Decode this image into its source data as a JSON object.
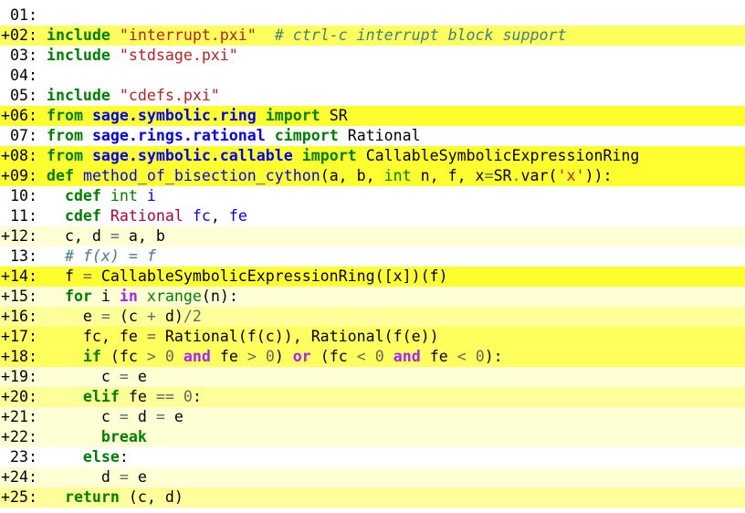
{
  "code_view": {
    "lines": [
      {
        "number": " 01:",
        "intensity": 0,
        "tokens": []
      },
      {
        "number": "+02:",
        "intensity": 3,
        "tokens": [
          {
            "t": " "
          },
          {
            "t": "include",
            "c": "kw"
          },
          {
            "t": " "
          },
          {
            "t": "\"interrupt.pxi\"",
            "c": "str"
          },
          {
            "t": "  "
          },
          {
            "t": "# ctrl-c interrupt block support",
            "c": "com"
          }
        ]
      },
      {
        "number": " 03:",
        "intensity": 0,
        "tokens": [
          {
            "t": " "
          },
          {
            "t": "include",
            "c": "kw"
          },
          {
            "t": " "
          },
          {
            "t": "\"stdsage.pxi\"",
            "c": "str"
          }
        ]
      },
      {
        "number": " 04:",
        "intensity": 0,
        "tokens": []
      },
      {
        "number": " 05:",
        "intensity": 0,
        "tokens": [
          {
            "t": " "
          },
          {
            "t": "include",
            "c": "kw"
          },
          {
            "t": " "
          },
          {
            "t": "\"cdefs.pxi\"",
            "c": "str"
          }
        ]
      },
      {
        "number": "+06:",
        "intensity": 4,
        "tokens": [
          {
            "t": " "
          },
          {
            "t": "from",
            "c": "kw"
          },
          {
            "t": " "
          },
          {
            "t": "sage.symbolic.ring",
            "c": "ns"
          },
          {
            "t": " "
          },
          {
            "t": "import",
            "c": "kw"
          },
          {
            "t": " "
          },
          {
            "t": "SR",
            "c": "n"
          }
        ]
      },
      {
        "number": " 07:",
        "intensity": 0,
        "tokens": [
          {
            "t": " "
          },
          {
            "t": "from",
            "c": "kw"
          },
          {
            "t": " "
          },
          {
            "t": "sage.rings.rational",
            "c": "ns"
          },
          {
            "t": " "
          },
          {
            "t": "cimport",
            "c": "kw"
          },
          {
            "t": " "
          },
          {
            "t": "Rational",
            "c": "n"
          }
        ]
      },
      {
        "number": "+08:",
        "intensity": 4,
        "tokens": [
          {
            "t": " "
          },
          {
            "t": "from",
            "c": "kw"
          },
          {
            "t": " "
          },
          {
            "t": "sage.symbolic.callable",
            "c": "ns"
          },
          {
            "t": " "
          },
          {
            "t": "import",
            "c": "kw"
          },
          {
            "t": " "
          },
          {
            "t": "CallableSymbolicExpressionRing",
            "c": "n"
          }
        ]
      },
      {
        "number": "+09:",
        "intensity": 4,
        "tokens": [
          {
            "t": " "
          },
          {
            "t": "def",
            "c": "kw"
          },
          {
            "t": " "
          },
          {
            "t": "method_of_bisection_cython",
            "c": "fn"
          },
          {
            "t": "(a, b, "
          },
          {
            "t": "int",
            "c": "bi"
          },
          {
            "t": " n, f, x"
          },
          {
            "t": "=",
            "c": "op"
          },
          {
            "t": "SR"
          },
          {
            "t": ".",
            "c": "op"
          },
          {
            "t": "var("
          },
          {
            "t": "'x'",
            "c": "str"
          },
          {
            "t": ")):"
          }
        ]
      },
      {
        "number": " 10:",
        "intensity": 0,
        "tokens": [
          {
            "t": "   "
          },
          {
            "t": "cdef",
            "c": "kw"
          },
          {
            "t": " "
          },
          {
            "t": "int",
            "c": "bi"
          },
          {
            "t": " "
          },
          {
            "t": "i",
            "c": "fn"
          }
        ]
      },
      {
        "number": " 11:",
        "intensity": 0,
        "tokens": [
          {
            "t": "   "
          },
          {
            "t": "cdef",
            "c": "kw"
          },
          {
            "t": " "
          },
          {
            "t": "Rational",
            "c": "cls"
          },
          {
            "t": " "
          },
          {
            "t": "fc",
            "c": "fn"
          },
          {
            "t": ", "
          },
          {
            "t": "fe",
            "c": "fn"
          }
        ]
      },
      {
        "number": "+12:",
        "intensity": 1,
        "tokens": [
          {
            "t": "   c, d "
          },
          {
            "t": "=",
            "c": "op"
          },
          {
            "t": " a, b"
          }
        ]
      },
      {
        "number": " 13:",
        "intensity": 0,
        "tokens": [
          {
            "t": "   "
          },
          {
            "t": "# f(x) = f",
            "c": "com"
          }
        ]
      },
      {
        "number": "+14:",
        "intensity": 4,
        "tokens": [
          {
            "t": "   f "
          },
          {
            "t": "=",
            "c": "op"
          },
          {
            "t": " CallableSymbolicExpressionRing([x])(f)"
          }
        ]
      },
      {
        "number": "+15:",
        "intensity": 1,
        "tokens": [
          {
            "t": "   "
          },
          {
            "t": "for",
            "c": "kw"
          },
          {
            "t": " i "
          },
          {
            "t": "in",
            "c": "kw2"
          },
          {
            "t": " "
          },
          {
            "t": "xrange",
            "c": "bi"
          },
          {
            "t": "(n):"
          }
        ]
      },
      {
        "number": "+16:",
        "intensity": 2,
        "tokens": [
          {
            "t": "     e "
          },
          {
            "t": "=",
            "c": "op"
          },
          {
            "t": " (c "
          },
          {
            "t": "+",
            "c": "op"
          },
          {
            "t": " d)"
          },
          {
            "t": "/",
            "c": "op"
          },
          {
            "t": "2",
            "c": "num"
          }
        ]
      },
      {
        "number": "+17:",
        "intensity": 3,
        "tokens": [
          {
            "t": "     fc, fe "
          },
          {
            "t": "=",
            "c": "op"
          },
          {
            "t": " Rational(f(c)), Rational(f(e))"
          }
        ]
      },
      {
        "number": "+18:",
        "intensity": 3,
        "tokens": [
          {
            "t": "     "
          },
          {
            "t": "if",
            "c": "kw"
          },
          {
            "t": " (fc "
          },
          {
            "t": ">",
            "c": "op"
          },
          {
            "t": " "
          },
          {
            "t": "0",
            "c": "num"
          },
          {
            "t": " "
          },
          {
            "t": "and",
            "c": "kw2"
          },
          {
            "t": " fe "
          },
          {
            "t": ">",
            "c": "op"
          },
          {
            "t": " "
          },
          {
            "t": "0",
            "c": "num"
          },
          {
            "t": ") "
          },
          {
            "t": "or",
            "c": "kw2"
          },
          {
            "t": " (fc "
          },
          {
            "t": "<",
            "c": "op"
          },
          {
            "t": " "
          },
          {
            "t": "0",
            "c": "num"
          },
          {
            "t": " "
          },
          {
            "t": "and",
            "c": "kw2"
          },
          {
            "t": " fe "
          },
          {
            "t": "<",
            "c": "op"
          },
          {
            "t": " "
          },
          {
            "t": "0",
            "c": "num"
          },
          {
            "t": "):"
          }
        ]
      },
      {
        "number": "+19:",
        "intensity": 1,
        "tokens": [
          {
            "t": "       c "
          },
          {
            "t": "=",
            "c": "op"
          },
          {
            "t": " e"
          }
        ]
      },
      {
        "number": "+20:",
        "intensity": 2,
        "tokens": [
          {
            "t": "     "
          },
          {
            "t": "elif",
            "c": "kw"
          },
          {
            "t": " fe "
          },
          {
            "t": "==",
            "c": "op"
          },
          {
            "t": " "
          },
          {
            "t": "0",
            "c": "num"
          },
          {
            "t": ":"
          }
        ]
      },
      {
        "number": "+21:",
        "intensity": 1,
        "tokens": [
          {
            "t": "       c "
          },
          {
            "t": "=",
            "c": "op"
          },
          {
            "t": " d "
          },
          {
            "t": "=",
            "c": "op"
          },
          {
            "t": " e"
          }
        ]
      },
      {
        "number": "+22:",
        "intensity": 1,
        "tokens": [
          {
            "t": "       "
          },
          {
            "t": "break",
            "c": "kw"
          }
        ]
      },
      {
        "number": " 23:",
        "intensity": 0,
        "tokens": [
          {
            "t": "     "
          },
          {
            "t": "else",
            "c": "kw"
          },
          {
            "t": ":"
          }
        ]
      },
      {
        "number": "+24:",
        "intensity": 1,
        "tokens": [
          {
            "t": "       d "
          },
          {
            "t": "=",
            "c": "op"
          },
          {
            "t": " e"
          }
        ]
      },
      {
        "number": "+25:",
        "intensity": 2,
        "tokens": [
          {
            "t": "   "
          },
          {
            "t": "return",
            "c": "kw"
          },
          {
            "t": " (c, d)"
          }
        ]
      }
    ]
  }
}
